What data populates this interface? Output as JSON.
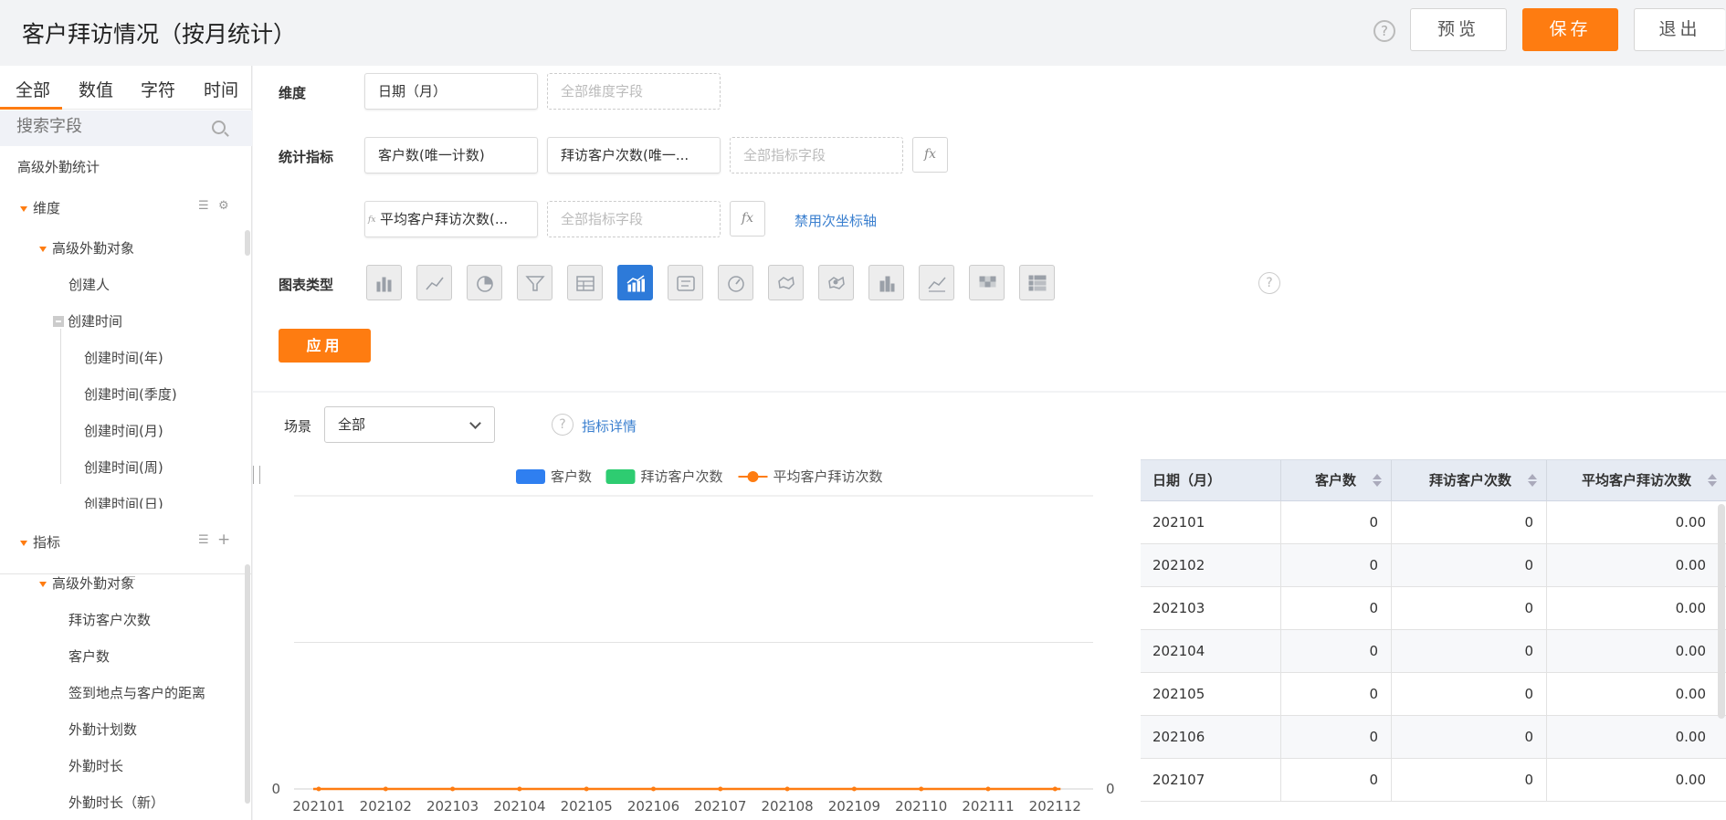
{
  "header": {
    "title": "客户拜访情况（按月统计）",
    "help": "?",
    "preview_label": "预览",
    "save_label": "保存",
    "exit_label": "退出"
  },
  "sidebar": {
    "tabs": [
      "全部",
      "数值",
      "字符",
      "时间"
    ],
    "search_placeholder": "搜索字段",
    "root": "高级外勤统计",
    "dimension_section": "维度",
    "dimension_group": "高级外勤对象",
    "dimension_items": [
      "创建人",
      "创建时间"
    ],
    "time_items": [
      "创建时间(年)",
      "创建时间(季度)",
      "创建时间(月)",
      "创建时间(周)",
      "创建时间(日)"
    ],
    "metric_section": "指标",
    "metric_group": "高级外勤对象",
    "metric_items": [
      "拜访客户次数",
      "客户数",
      "签到地点与客户的距离",
      "外勤计划数",
      "外勤时长",
      "外勤时长（新）"
    ]
  },
  "config": {
    "dimension_label": "维度",
    "dimension_field": "日期（月）",
    "dimension_placeholder": "全部维度字段",
    "metrics_label": "统计指标",
    "metric_fields": [
      "客户数(唯一计数)",
      "拜访客户次数(唯一...",
      "平均客户拜访次数(..."
    ],
    "metric_placeholder": "全部指标字段",
    "fx": "fx",
    "secondary_axis_link": "禁用次坐标轴",
    "chart_type_label": "图表类型",
    "chart_types": [
      "bar-chart-icon",
      "line-chart-icon",
      "pie-chart-icon",
      "funnel-chart-icon",
      "table-chart-icon",
      "combo-chart-icon",
      "card-chart-icon",
      "gauge-chart-icon",
      "map-chart-icon",
      "scatter-map-icon",
      "stacked-bar-icon",
      "area-chart-icon",
      "heatmap-chart-icon",
      "pivot-table-icon"
    ],
    "active_chart_type": "combo-chart-icon",
    "apply_label": "应用"
  },
  "preview": {
    "scene_label": "场景",
    "scene_value": "全部",
    "metric_detail_link": "指标详情"
  },
  "colors": {
    "accent": "#fe7c11",
    "series_customers": "#2f7ff0",
    "series_visits": "#2ecc71",
    "series_avg": "#fe7c11",
    "active_chart": "#2d7ad9"
  },
  "chart_data": {
    "type": "combo",
    "categories": [
      "202101",
      "202102",
      "202103",
      "202104",
      "202105",
      "202106",
      "202107",
      "202108",
      "202109",
      "202110",
      "202111",
      "202112"
    ],
    "series": [
      {
        "name": "客户数",
        "kind": "bar",
        "axis": "left",
        "values": [
          0,
          0,
          0,
          0,
          0,
          0,
          0,
          0,
          0,
          0,
          0,
          0
        ]
      },
      {
        "name": "拜访客户次数",
        "kind": "bar",
        "axis": "left",
        "values": [
          0,
          0,
          0,
          0,
          0,
          0,
          0,
          0,
          0,
          0,
          0,
          0
        ]
      },
      {
        "name": "平均客户拜访次数",
        "kind": "line",
        "axis": "right",
        "values": [
          0,
          0,
          0,
          0,
          0,
          0,
          0,
          0,
          0,
          0,
          0,
          0
        ]
      }
    ],
    "y_left_ticks": [
      "0"
    ],
    "y_right_ticks": [
      "0"
    ],
    "legend_position": "top-center",
    "grid": true
  },
  "table": {
    "columns": [
      "日期（月）",
      "客户数",
      "拜访客户次数",
      "平均客户拜访次数"
    ],
    "rows": [
      [
        "202101",
        "0",
        "0",
        "0.00"
      ],
      [
        "202102",
        "0",
        "0",
        "0.00"
      ],
      [
        "202103",
        "0",
        "0",
        "0.00"
      ],
      [
        "202104",
        "0",
        "0",
        "0.00"
      ],
      [
        "202105",
        "0",
        "0",
        "0.00"
      ],
      [
        "202106",
        "0",
        "0",
        "0.00"
      ],
      [
        "202107",
        "0",
        "0",
        "0.00"
      ]
    ]
  }
}
